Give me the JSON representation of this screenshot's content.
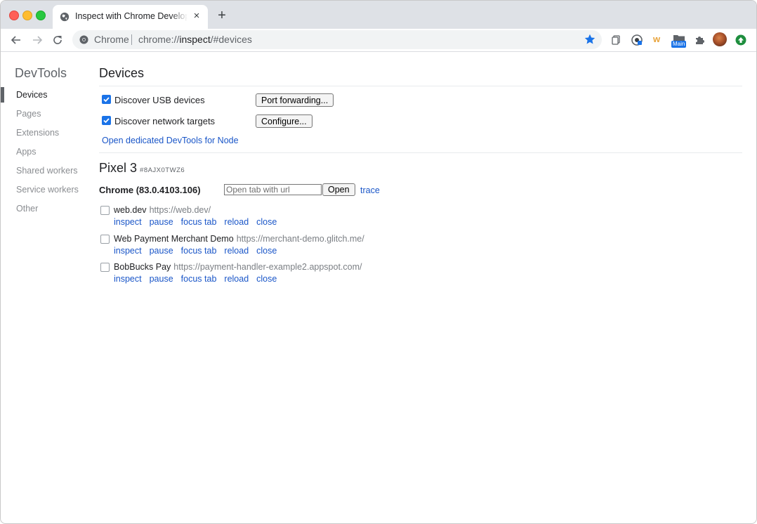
{
  "window": {
    "tab_title": "Inspect with Chrome Developer Tools",
    "new_tab_glyph": "+",
    "close_glyph": "×"
  },
  "toolbar": {
    "chip_label": "Chrome",
    "url_scheme": "chrome://",
    "url_host": "inspect",
    "url_path": "/#devices",
    "extension_badge": "Main",
    "extension_w": "w"
  },
  "sidebar": {
    "brand": "DevTools",
    "items": [
      {
        "label": "Devices",
        "active": true
      },
      {
        "label": "Pages",
        "active": false
      },
      {
        "label": "Extensions",
        "active": false
      },
      {
        "label": "Apps",
        "active": false
      },
      {
        "label": "Shared workers",
        "active": false
      },
      {
        "label": "Service workers",
        "active": false
      },
      {
        "label": "Other",
        "active": false
      }
    ]
  },
  "devices": {
    "title": "Devices",
    "discover_usb": {
      "label": "Discover USB devices",
      "checked": true
    },
    "discover_network": {
      "label": "Discover network targets",
      "checked": true
    },
    "port_forwarding_button": "Port forwarding...",
    "configure_button": "Configure...",
    "node_link": "Open dedicated DevTools for Node"
  },
  "device": {
    "name": "Pixel 3",
    "serial": "#8AJX0TWZ6",
    "browser": "Chrome (83.0.4103.106)",
    "url_placeholder": "Open tab with url",
    "open_button": "Open",
    "trace_link": "trace",
    "targets": [
      {
        "title": "web.dev",
        "url": "https://web.dev/"
      },
      {
        "title": "Web Payment Merchant Demo",
        "url": "https://merchant-demo.glitch.me/"
      },
      {
        "title": "BobBucks Pay",
        "url": "https://payment-handler-example2.appspot.com/"
      }
    ],
    "actions": [
      "inspect",
      "pause",
      "focus tab",
      "reload",
      "close"
    ]
  },
  "colors": {
    "accent": "#1a73e8",
    "link": "#1a56c8",
    "tabstrip": "#dee1e6",
    "omnibox": "#f1f3f4"
  }
}
